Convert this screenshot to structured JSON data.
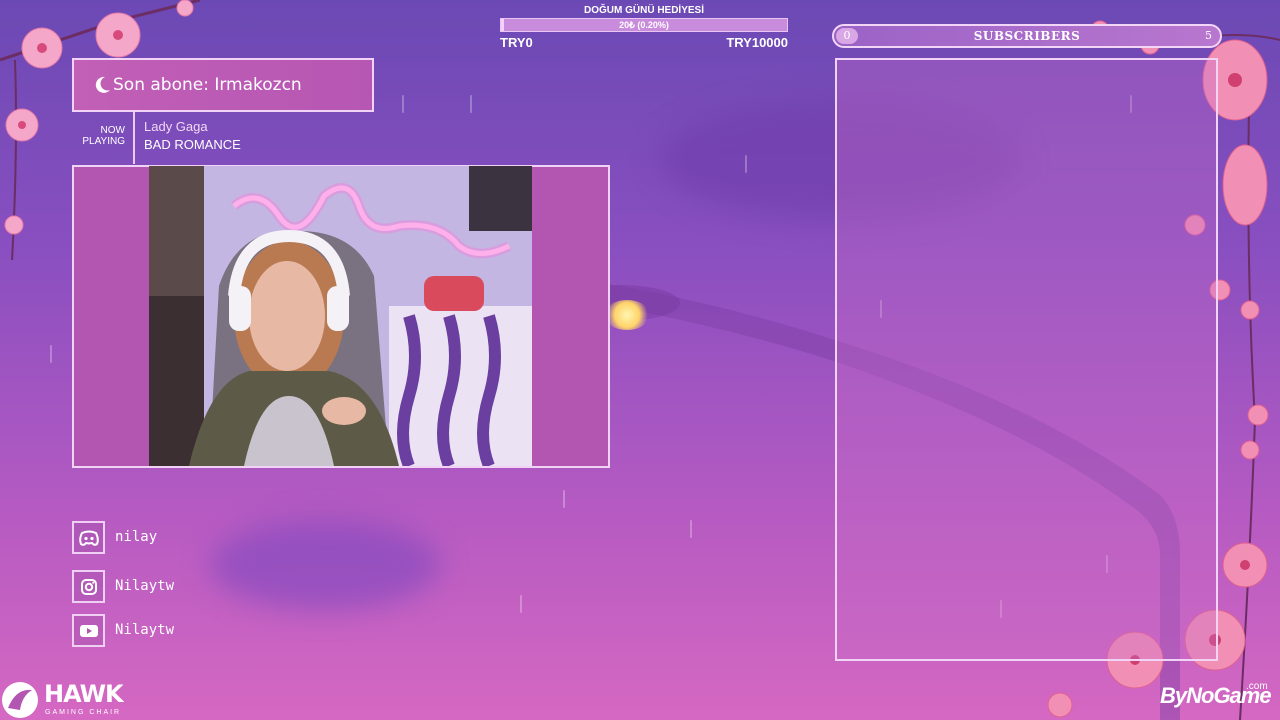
{
  "donation": {
    "title": "DOĞUM GÜNÜ HEDİYESİ",
    "progress_text": "20₺ (0.20%)",
    "progress_fraction": 0.002,
    "min_label": "TRY0",
    "max_label": "TRY10000"
  },
  "subscribers": {
    "start": "0",
    "label": "SUBSCRIBERS",
    "goal": "5"
  },
  "last_subscriber": {
    "text": "Son abone: Irmakozcn"
  },
  "now_playing": {
    "label_line1": "NOW",
    "label_line2": "PLAYING",
    "artist": "Lady Gaga",
    "song": "BAD ROMANCE"
  },
  "socials": [
    {
      "platform": "discord",
      "icon": "discord-icon",
      "handle": "nilay"
    },
    {
      "platform": "instagram",
      "icon": "instagram-icon",
      "handle": "Nilaytw"
    },
    {
      "platform": "youtube",
      "icon": "youtube-icon",
      "handle": "Nilaytw"
    }
  ],
  "sponsors": {
    "hawk_name": "HAWK",
    "hawk_tagline": "GAMING CHAIR",
    "bng_name": "ByNoGame",
    "bng_domain": ".com"
  },
  "colors": {
    "accent": "#f1d3f5",
    "bg_top": "#6b49b4",
    "bg_bottom": "#d568c2"
  }
}
